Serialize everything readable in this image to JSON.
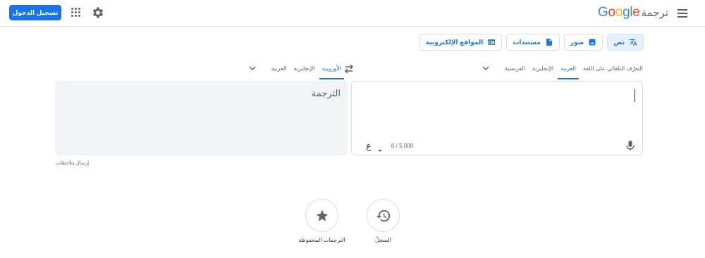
{
  "header": {
    "brand": "Google",
    "product": "ترجمة",
    "signin_label": "تسجيل الدخول",
    "icons": [
      "menu-icon",
      "settings-gear-icon",
      "apps-grid-icon"
    ]
  },
  "modes": [
    {
      "label": "نص",
      "icon": "translate-icon",
      "active": true
    },
    {
      "label": "صور",
      "icon": "image-icon",
      "active": false
    },
    {
      "label": "مستندات",
      "icon": "document-icon",
      "active": false
    },
    {
      "label": "المواقع الإلكترونية",
      "icon": "website-icon",
      "active": false
    }
  ],
  "source_langs": {
    "detect": "التعرّف التلقائي على اللغة",
    "items": [
      "العربية",
      "الإنجليزية",
      "الفرنسية"
    ],
    "selected": "العربية"
  },
  "target_langs": {
    "items": [
      "الأوروبية",
      "الإنجليزية",
      "العربية"
    ],
    "selected": "الأوروبية"
  },
  "source_panel": {
    "char_count": "0 / 5,000",
    "keyboard_glyph": "ع"
  },
  "target_panel": {
    "placeholder": "الترجمة"
  },
  "feedback_label": "إرسال ملاحظات",
  "bottom_actions": [
    {
      "label": "السجلّ",
      "icon": "history-icon"
    },
    {
      "label": "الترجمات المحفوظة",
      "icon": "star-icon"
    }
  ],
  "colors": {
    "accent": "#1a73e8",
    "active_tab_bg": "#e8f0fe",
    "target_bg": "#f1f3f4",
    "border": "#dadce0",
    "icon_gray": "#5f6368",
    "logo_blue": "#4285f4",
    "logo_red": "#ea4335",
    "logo_yellow": "#fbbc05",
    "logo_green": "#34a853"
  }
}
